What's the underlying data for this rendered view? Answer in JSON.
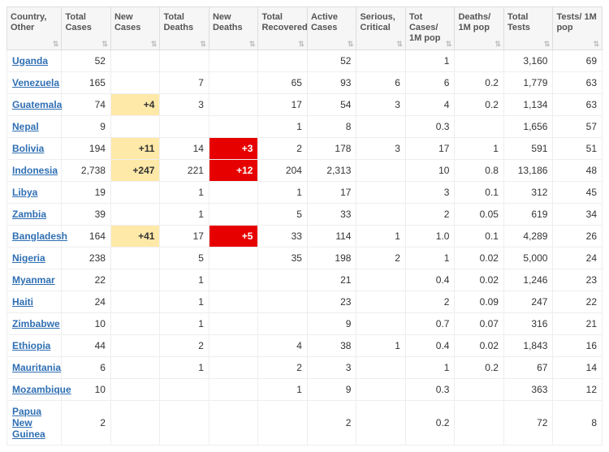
{
  "columns": [
    "Country, Other",
    "Total Cases",
    "New Cases",
    "Total Deaths",
    "New Deaths",
    "Total Recovered",
    "Active Cases",
    "Serious, Critical",
    "Tot Cases/ 1M pop",
    "Deaths/ 1M pop",
    "Total Tests",
    "Tests/ 1M pop"
  ],
  "rows": [
    {
      "country": "Uganda",
      "total_cases": "52",
      "new_cases": "",
      "total_deaths": "",
      "new_deaths": "",
      "total_recovered": "",
      "active_cases": "52",
      "serious": "",
      "cases_1m": "1",
      "deaths_1m": "",
      "total_tests": "3,160",
      "tests_1m": "69"
    },
    {
      "country": "Venezuela",
      "total_cases": "165",
      "new_cases": "",
      "total_deaths": "7",
      "new_deaths": "",
      "total_recovered": "65",
      "active_cases": "93",
      "serious": "6",
      "cases_1m": "6",
      "deaths_1m": "0.2",
      "total_tests": "1,779",
      "tests_1m": "63"
    },
    {
      "country": "Guatemala",
      "total_cases": "74",
      "new_cases": "+4",
      "new_cases_hl": "yellow",
      "total_deaths": "3",
      "new_deaths": "",
      "total_recovered": "17",
      "active_cases": "54",
      "serious": "3",
      "cases_1m": "4",
      "deaths_1m": "0.2",
      "total_tests": "1,134",
      "tests_1m": "63"
    },
    {
      "country": "Nepal",
      "total_cases": "9",
      "new_cases": "",
      "total_deaths": "",
      "new_deaths": "",
      "total_recovered": "1",
      "active_cases": "8",
      "serious": "",
      "cases_1m": "0.3",
      "deaths_1m": "",
      "total_tests": "1,656",
      "tests_1m": "57"
    },
    {
      "country": "Bolivia",
      "total_cases": "194",
      "new_cases": "+11",
      "new_cases_hl": "yellow",
      "total_deaths": "14",
      "new_deaths": "+3",
      "new_deaths_hl": "red",
      "total_recovered": "2",
      "active_cases": "178",
      "serious": "3",
      "cases_1m": "17",
      "deaths_1m": "1",
      "total_tests": "591",
      "tests_1m": "51"
    },
    {
      "country": "Indonesia",
      "total_cases": "2,738",
      "new_cases": "+247",
      "new_cases_hl": "yellow",
      "total_deaths": "221",
      "new_deaths": "+12",
      "new_deaths_hl": "red",
      "total_recovered": "204",
      "active_cases": "2,313",
      "serious": "",
      "cases_1m": "10",
      "deaths_1m": "0.8",
      "total_tests": "13,186",
      "tests_1m": "48"
    },
    {
      "country": "Libya",
      "total_cases": "19",
      "new_cases": "",
      "total_deaths": "1",
      "new_deaths": "",
      "total_recovered": "1",
      "active_cases": "17",
      "serious": "",
      "cases_1m": "3",
      "deaths_1m": "0.1",
      "total_tests": "312",
      "tests_1m": "45"
    },
    {
      "country": "Zambia",
      "total_cases": "39",
      "new_cases": "",
      "total_deaths": "1",
      "new_deaths": "",
      "total_recovered": "5",
      "active_cases": "33",
      "serious": "",
      "cases_1m": "2",
      "deaths_1m": "0.05",
      "total_tests": "619",
      "tests_1m": "34"
    },
    {
      "country": "Bangladesh",
      "total_cases": "164",
      "new_cases": "+41",
      "new_cases_hl": "yellow",
      "total_deaths": "17",
      "new_deaths": "+5",
      "new_deaths_hl": "red",
      "total_recovered": "33",
      "active_cases": "114",
      "serious": "1",
      "cases_1m": "1.0",
      "deaths_1m": "0.1",
      "total_tests": "4,289",
      "tests_1m": "26"
    },
    {
      "country": "Nigeria",
      "total_cases": "238",
      "new_cases": "",
      "total_deaths": "5",
      "new_deaths": "",
      "total_recovered": "35",
      "active_cases": "198",
      "serious": "2",
      "cases_1m": "1",
      "deaths_1m": "0.02",
      "total_tests": "5,000",
      "tests_1m": "24"
    },
    {
      "country": "Myanmar",
      "total_cases": "22",
      "new_cases": "",
      "total_deaths": "1",
      "new_deaths": "",
      "total_recovered": "",
      "active_cases": "21",
      "serious": "",
      "cases_1m": "0.4",
      "deaths_1m": "0.02",
      "total_tests": "1,246",
      "tests_1m": "23"
    },
    {
      "country": "Haiti",
      "total_cases": "24",
      "new_cases": "",
      "total_deaths": "1",
      "new_deaths": "",
      "total_recovered": "",
      "active_cases": "23",
      "serious": "",
      "cases_1m": "2",
      "deaths_1m": "0.09",
      "total_tests": "247",
      "tests_1m": "22"
    },
    {
      "country": "Zimbabwe",
      "total_cases": "10",
      "new_cases": "",
      "total_deaths": "1",
      "new_deaths": "",
      "total_recovered": "",
      "active_cases": "9",
      "serious": "",
      "cases_1m": "0.7",
      "deaths_1m": "0.07",
      "total_tests": "316",
      "tests_1m": "21"
    },
    {
      "country": "Ethiopia",
      "total_cases": "44",
      "new_cases": "",
      "total_deaths": "2",
      "new_deaths": "",
      "total_recovered": "4",
      "active_cases": "38",
      "serious": "1",
      "cases_1m": "0.4",
      "deaths_1m": "0.02",
      "total_tests": "1,843",
      "tests_1m": "16"
    },
    {
      "country": "Mauritania",
      "total_cases": "6",
      "new_cases": "",
      "total_deaths": "1",
      "new_deaths": "",
      "total_recovered": "2",
      "active_cases": "3",
      "serious": "",
      "cases_1m": "1",
      "deaths_1m": "0.2",
      "total_tests": "67",
      "tests_1m": "14"
    },
    {
      "country": "Mozambique",
      "total_cases": "10",
      "new_cases": "",
      "total_deaths": "",
      "new_deaths": "",
      "total_recovered": "1",
      "active_cases": "9",
      "serious": "",
      "cases_1m": "0.3",
      "deaths_1m": "",
      "total_tests": "363",
      "tests_1m": "12"
    },
    {
      "country": "Papua New Guinea",
      "total_cases": "2",
      "new_cases": "",
      "total_deaths": "",
      "new_deaths": "",
      "total_recovered": "",
      "active_cases": "2",
      "serious": "",
      "cases_1m": "0.2",
      "deaths_1m": "",
      "total_tests": "72",
      "tests_1m": "8"
    }
  ]
}
